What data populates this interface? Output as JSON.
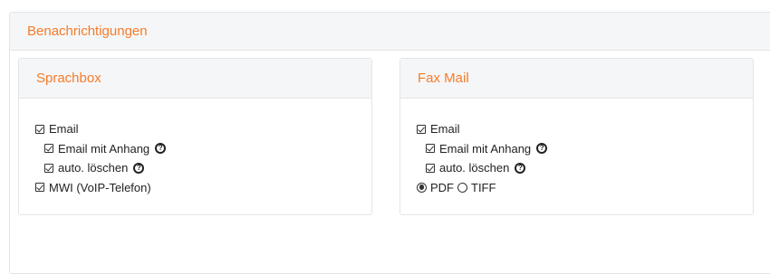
{
  "section": {
    "title": "Benachrichtigungen"
  },
  "sprachbox": {
    "title": "Sprachbox",
    "email_label": "Email",
    "email_attachment_label": "Email mit Anhang",
    "auto_delete_label": "auto. löschen",
    "mwi_label": "MWI (VoIP-Telefon)",
    "email_checked": true,
    "email_attachment_checked": true,
    "auto_delete_checked": true,
    "mwi_checked": true
  },
  "faxmail": {
    "title": "Fax Mail",
    "email_label": "Email",
    "email_attachment_label": "Email mit Anhang",
    "auto_delete_label": "auto. löschen",
    "format_options": [
      "PDF",
      "TIFF"
    ],
    "format_selected": "PDF",
    "email_checked": true,
    "email_attachment_checked": true,
    "auto_delete_checked": true
  },
  "help_icon_glyph": "?",
  "colors": {
    "accent": "#f57c2a",
    "header_bg": "#f5f6f7",
    "border": "#e2e5e8"
  }
}
